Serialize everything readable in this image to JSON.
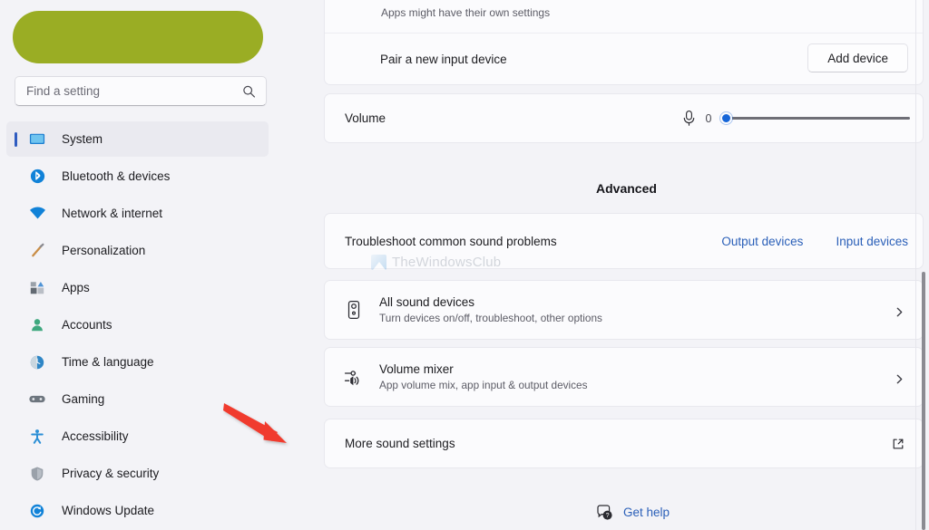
{
  "sidebar": {
    "account": {
      "avatar_icon": "landscape-avatar",
      "redacted": true,
      "redaction_color": "#9aad24"
    },
    "search": {
      "placeholder": "Find a setting",
      "value": "",
      "icon": "search-icon"
    },
    "items": [
      {
        "label": "System",
        "icon": "monitor-icon",
        "active": true
      },
      {
        "label": "Bluetooth & devices",
        "icon": "bluetooth-icon",
        "active": false
      },
      {
        "label": "Network & internet",
        "icon": "wifi-icon",
        "active": false
      },
      {
        "label": "Personalization",
        "icon": "paintbrush-icon",
        "active": false
      },
      {
        "label": "Apps",
        "icon": "apps-icon",
        "active": false
      },
      {
        "label": "Accounts",
        "icon": "person-icon",
        "active": false
      },
      {
        "label": "Time & language",
        "icon": "clock-globe-icon",
        "active": false
      },
      {
        "label": "Gaming",
        "icon": "gamepad-icon",
        "active": false
      },
      {
        "label": "Accessibility",
        "icon": "accessibility-icon",
        "active": false
      },
      {
        "label": "Privacy & security",
        "icon": "shield-icon",
        "active": false
      },
      {
        "label": "Windows Update",
        "icon": "update-icon",
        "active": false
      }
    ]
  },
  "main": {
    "top_card": {
      "note": "Apps might have their own settings",
      "pair_label": "Pair a new input device",
      "add_device_button": "Add device"
    },
    "volume": {
      "label": "Volume",
      "mic_icon": "microphone-icon",
      "value": "0",
      "slider_percent": 0
    },
    "advanced": {
      "heading": "Advanced",
      "troubleshoot": {
        "label": "Troubleshoot common sound problems",
        "output_link": "Output devices",
        "input_link": "Input devices"
      },
      "rows": [
        {
          "title": "All sound devices",
          "subtitle": "Turn devices on/off, troubleshoot, other options",
          "icon": "speaker-device-icon",
          "chevron": "chevron-right-icon"
        },
        {
          "title": "Volume mixer",
          "subtitle": "App volume mix, app input & output devices",
          "icon": "volume-mixer-icon",
          "chevron": "chevron-right-icon"
        }
      ],
      "more_sound_settings": {
        "label": "More sound settings",
        "icon": "external-link-icon"
      }
    },
    "get_help": {
      "label": "Get help",
      "icon": "help-icon"
    }
  },
  "watermark": {
    "text": "TheWindowsClub",
    "logo_icon": "windowsclub-logo-icon"
  },
  "annotation": {
    "arrow_color": "#f03a2e",
    "points_to": "More sound settings"
  },
  "colors": {
    "page_background": "#f3f3f7",
    "card_background": "#fbfbfd",
    "accent_blue": "#2a5fb8",
    "slider_thumb": "#1565d8",
    "active_indicator": "#2f5cc0"
  }
}
